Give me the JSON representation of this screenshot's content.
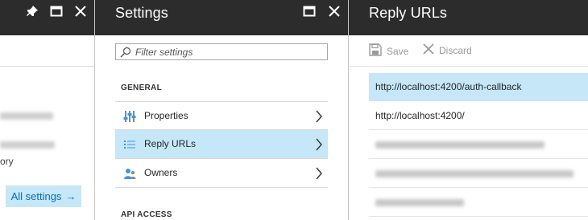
{
  "left_blade": {
    "partial_text": "ory",
    "all_settings_label": "All settings",
    "all_settings_arrow": "→"
  },
  "settings_blade": {
    "title": "Settings",
    "filter": {
      "placeholder": "Filter settings",
      "value": ""
    },
    "sections": [
      {
        "label": "GENERAL",
        "items": [
          {
            "label": "Properties",
            "icon": "properties-icon",
            "selected": false
          },
          {
            "label": "Reply URLs",
            "icon": "list-icon",
            "selected": true
          },
          {
            "label": "Owners",
            "icon": "owners-icon",
            "selected": false
          }
        ]
      },
      {
        "label": "API ACCESS",
        "items": []
      }
    ]
  },
  "reply_blade": {
    "title": "Reply URLs",
    "toolbar": {
      "save_label": "Save",
      "discard_label": "Discard"
    },
    "urls": [
      {
        "value": "http://localhost:4200/auth-callback",
        "selected": true,
        "redacted": false
      },
      {
        "value": "http://localhost:4200/",
        "selected": false,
        "redacted": false
      },
      {
        "value": "",
        "selected": false,
        "redacted": true
      },
      {
        "value": "",
        "selected": false,
        "redacted": true
      },
      {
        "value": "",
        "selected": false,
        "redacted": true
      }
    ]
  },
  "colors": {
    "header_bg": "#2c2c2c",
    "selected_bg": "#c5e7f7",
    "link_blue": "#0b6bb0"
  }
}
